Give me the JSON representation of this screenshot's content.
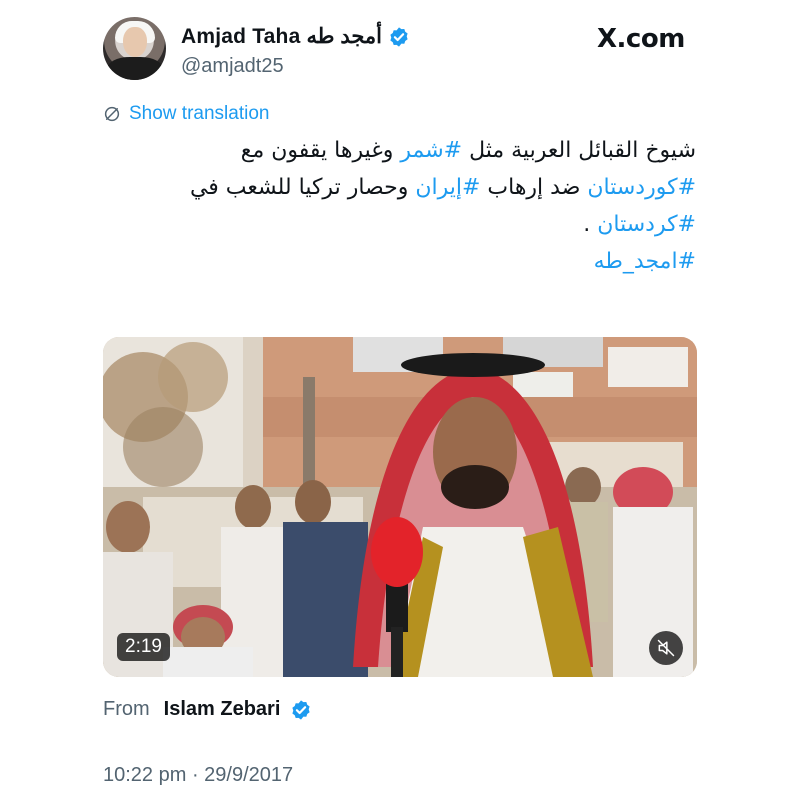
{
  "header": {
    "display_name": "Amjad Taha أمجد طه",
    "handle": "@amjadt25",
    "site_label": "X.com",
    "verified_icon": "verified-badge-icon"
  },
  "translation": {
    "label": "Show translation",
    "icon": "globe-translate-icon"
  },
  "tweet": {
    "line1_text": "شيوخ القبائل العربية مثل  ",
    "line1_tag": "#شمر",
    "line1_rest": " وغيرها يقفون مع",
    "line2_tag1": "#كوردستان",
    "line2_mid": " ضد إرهاب ",
    "line2_tag2": "#إيران",
    "line2_rest": " وحصار تركيا للشعب  في",
    "line3_tag": "#كردستان",
    "line3_rest": " .",
    "line4_tag": "#امجد_طه"
  },
  "media": {
    "duration": "2:19",
    "mute_icon": "muted-speaker-icon",
    "colors": {
      "shemagh_red": "#c8303a",
      "mic_red": "#e3232a",
      "wall": "#cf9a7a"
    }
  },
  "attribution": {
    "from_label": "From",
    "from_name": "Islam Zebari"
  },
  "meta": {
    "timestamp": "10:22 pm · 29/9/2017"
  }
}
